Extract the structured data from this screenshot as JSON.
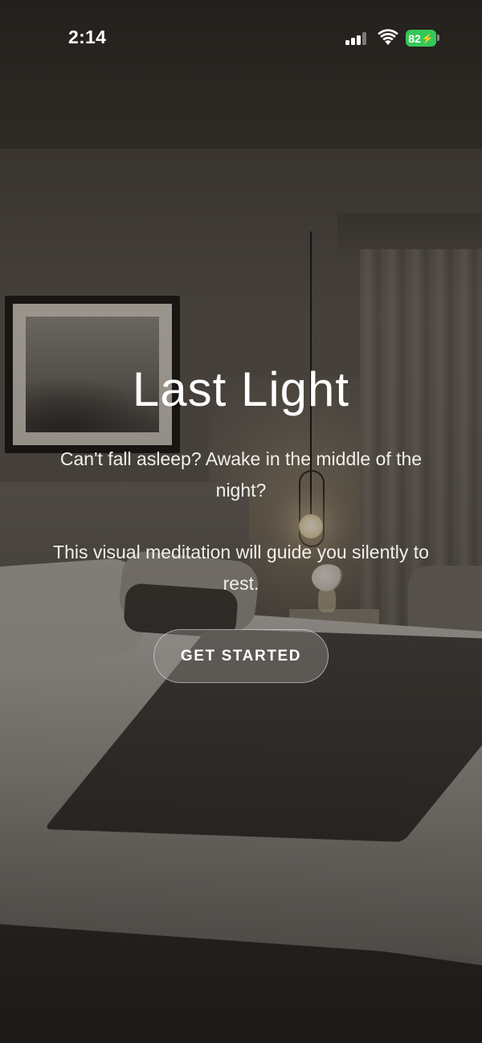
{
  "status_bar": {
    "time": "2:14",
    "battery_level": "82",
    "battery_color": "#34c759",
    "icons": [
      "cellular-signal-icon",
      "wifi-icon",
      "battery-charging-icon"
    ]
  },
  "background": {
    "description_icon": "bedroom-photo",
    "overlay_color": "#0f0d0b"
  },
  "hero": {
    "title": "Last Light",
    "tagline": "Can't fall asleep? Awake in the middle of the night?",
    "description": "This visual meditation will guide you silently to rest."
  },
  "cta": {
    "label": "GET STARTED"
  }
}
